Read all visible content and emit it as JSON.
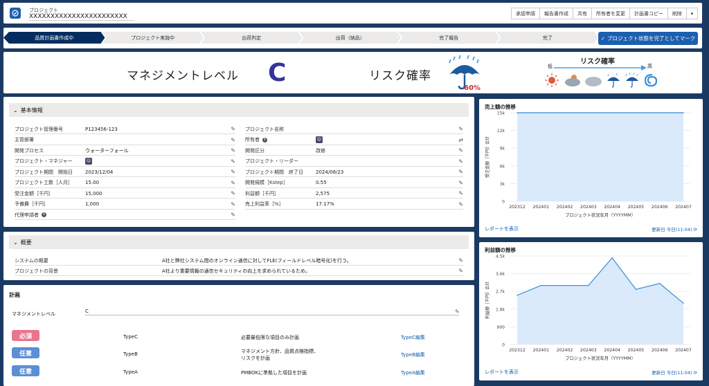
{
  "header": {
    "object_label": "プロジェクト",
    "record_name": "XXXXXXXXXXXXXXXXXXXXXXX",
    "buttons": [
      "承認申請",
      "報告書作成",
      "共有",
      "所有者を変更",
      "計画書コピー",
      "削除"
    ]
  },
  "path": {
    "steps": [
      "品質計画書作成中",
      "プロジェクト実施中",
      "出荷判定",
      "出荷（納品）",
      "完了報告",
      "完了"
    ],
    "current": 0,
    "complete_button": "プロジェクト状態を完了としてマーク"
  },
  "banner": {
    "management_level_label": "マネジメントレベル",
    "management_level": "C",
    "risk_label": "リスク確率",
    "risk_percent": "60%",
    "risk_scale_title": "リスク確率",
    "low": "低",
    "high": "高"
  },
  "basic_info": {
    "title": "基本情報",
    "left": [
      {
        "label": "プロジェクト管理番号",
        "value": "P123456-123"
      },
      {
        "label": "主管部署",
        "value": ""
      },
      {
        "label": "開発プロセス",
        "value": "ウォーターフォール"
      },
      {
        "label": "プロジェクト・マネジャー",
        "value": ""
      },
      {
        "label": "プロジェクト期間　開始日",
        "value": "2023/12/04"
      },
      {
        "label": "プロジェクト工数［人月］",
        "value": "15.00"
      },
      {
        "label": "受注金額［千円］",
        "value": "15,000"
      },
      {
        "label": "予備費［千円］",
        "value": "1,000"
      },
      {
        "label": "代理申請者",
        "value": ""
      }
    ],
    "right": [
      {
        "label": "プロジェクト名称",
        "value": ""
      },
      {
        "label": "所有者",
        "value": ""
      },
      {
        "label": "開発区分",
        "value": "改修"
      },
      {
        "label": "プロジェクト・リーダー",
        "value": ""
      },
      {
        "label": "プロジェクト期間　終了日",
        "value": "2024/08/23"
      },
      {
        "label": "開発規模［Kstep］",
        "value": "0.55"
      },
      {
        "label": "利益額［千円］",
        "value": "2,575"
      },
      {
        "label": "売上利益率［%］",
        "value": "17.17%"
      }
    ]
  },
  "overview": {
    "title": "概要",
    "rows": [
      {
        "label": "システムの概要",
        "value": "A社と弊社システム間のオンライン通信に対してFLE(フィールドレベル暗号化)を行う。"
      },
      {
        "label": "プロジェクトの背景",
        "value": "A社より重要情報の通信セキュリティの向上を求められているため。"
      }
    ]
  },
  "plan": {
    "title": "計画",
    "level_label": "マネジメントレベル",
    "level_value": "C",
    "items": [
      {
        "tag": "必須",
        "color": "#e8758e",
        "type": "TypeC",
        "desc1": "必要最低限な項目のみ計画",
        "desc2": "",
        "link": "TypeC編集"
      },
      {
        "tag": "任意",
        "color": "#5b8fd6",
        "type": "TypeB",
        "desc1": "マネジメント方針、品質点検指標、",
        "desc2": "リスクを計画",
        "link": "TypeB編集"
      },
      {
        "tag": "任意",
        "color": "#5b8fd6",
        "type": "TypeA",
        "desc1": "PMBOKに準拠した項目を計画",
        "desc2": "",
        "link": "TypeA編集"
      }
    ]
  },
  "report_link": "レポートを表示",
  "updated": "更新日 今日(11:04)",
  "chart_data": [
    {
      "type": "area",
      "title": "売上額の推移",
      "xlabel": "プロジェクト状況年月（YYYYMM）",
      "ylabel": "受注金額［千円］合計",
      "categories": [
        "202312",
        "202401",
        "202402",
        "202403",
        "202404",
        "202405",
        "202406",
        "202407"
      ],
      "values": [
        15000,
        15000,
        15000,
        15000,
        15000,
        15000,
        15000,
        15000
      ],
      "yticks": [
        0,
        3000,
        6000,
        9000,
        12000,
        15000
      ],
      "ytick_labels": [
        "0",
        "3k",
        "6k",
        "9k",
        "12k",
        "15k"
      ],
      "ylim": [
        0,
        15000
      ],
      "color": "#4b9bd9"
    },
    {
      "type": "area",
      "title": "利益額の推移",
      "xlabel": "プロジェクト状況年月（YYYYMM）",
      "ylabel": "利益額［千円］合計",
      "categories": [
        "202312",
        "202401",
        "202402",
        "202403",
        "202404",
        "202405",
        "202406",
        "202407"
      ],
      "values": [
        2500,
        3000,
        3000,
        3000,
        4400,
        2800,
        3100,
        2100
      ],
      "yticks": [
        0,
        900,
        1800,
        2700,
        3600,
        4500
      ],
      "ytick_labels": [
        "0",
        "900",
        "1.8k",
        "2.7k",
        "3.6k",
        "4.5k"
      ],
      "ylim": [
        0,
        4500
      ],
      "color": "#4b9bd9"
    }
  ]
}
